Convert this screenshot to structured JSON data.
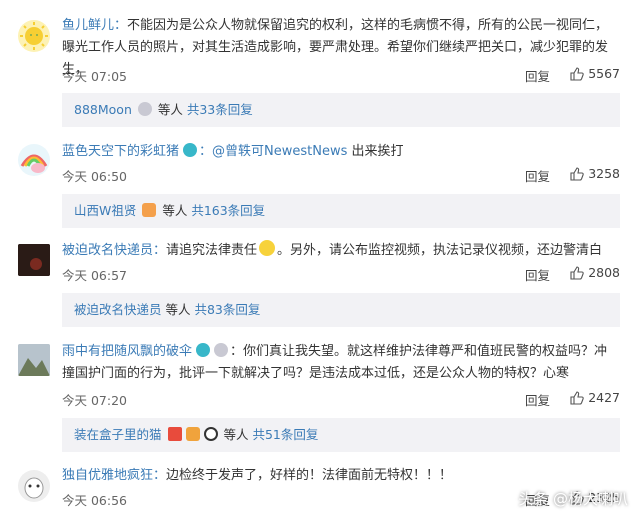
{
  "comments": [
    {
      "user": "鱼儿鲜儿：",
      "text": "不能因为是公众人物就保留追究的权利，这样的毛病惯不得，所有的公民一视同仁，曝光工作人员的照片，对其生活造成影响，要严肃处理。希望你们继续严把关口，减少犯罪的发生，",
      "time": "今天 07:05",
      "reply": "回复",
      "likes": "5567",
      "sub": {
        "who": "888Moon",
        "mid": " 等人 ",
        "count": "共33条回复"
      }
    },
    {
      "user": "蓝色天空下的彩虹猪",
      "mention": "：@曾轶可NewestNews",
      "text": " 出来挨打",
      "time": "今天 06:50",
      "reply": "回复",
      "likes": "3258",
      "sub": {
        "who": "山西W祖贤",
        "mid": " 等人 ",
        "count": "共163条回复"
      }
    },
    {
      "user": "被迫改名快递员：",
      "text_a": "请追究法律责任",
      "text_b": "。另外，请公布监控视频，执法记录仪视频，还边警清白",
      "time": "今天 06:57",
      "reply": "回复",
      "likes": "2808",
      "sub": {
        "who": "被迫改名快递员",
        "mid": " 等人 ",
        "count": "共83条回复"
      }
    },
    {
      "user": "雨中有把随风飘的破伞",
      "text": "：你们真让我失望。就这样维护法律尊严和值班民警的权益吗？冲撞国护门面的行为，批评一下就解决了吗？是违法成本过低，还是公众人物的特权？心寒",
      "time": "今天 07:20",
      "reply": "回复",
      "likes": "2427",
      "sub": {
        "who": "装在盒子里的猫",
        "mid": " 等人 ",
        "count": "共51条回复"
      }
    },
    {
      "user": "独自优雅地疯狂：",
      "text": "边检终于发声了，好样的！法律面前无特权！！！",
      "time": "今天 06:56",
      "reply": "回复",
      "likes": "2325"
    }
  ],
  "watermark": "头条 @杨大喇叭",
  "colors": {
    "accent": "#eb7350",
    "link": "#3b7bb6",
    "subbox": "#f2f2f5"
  }
}
